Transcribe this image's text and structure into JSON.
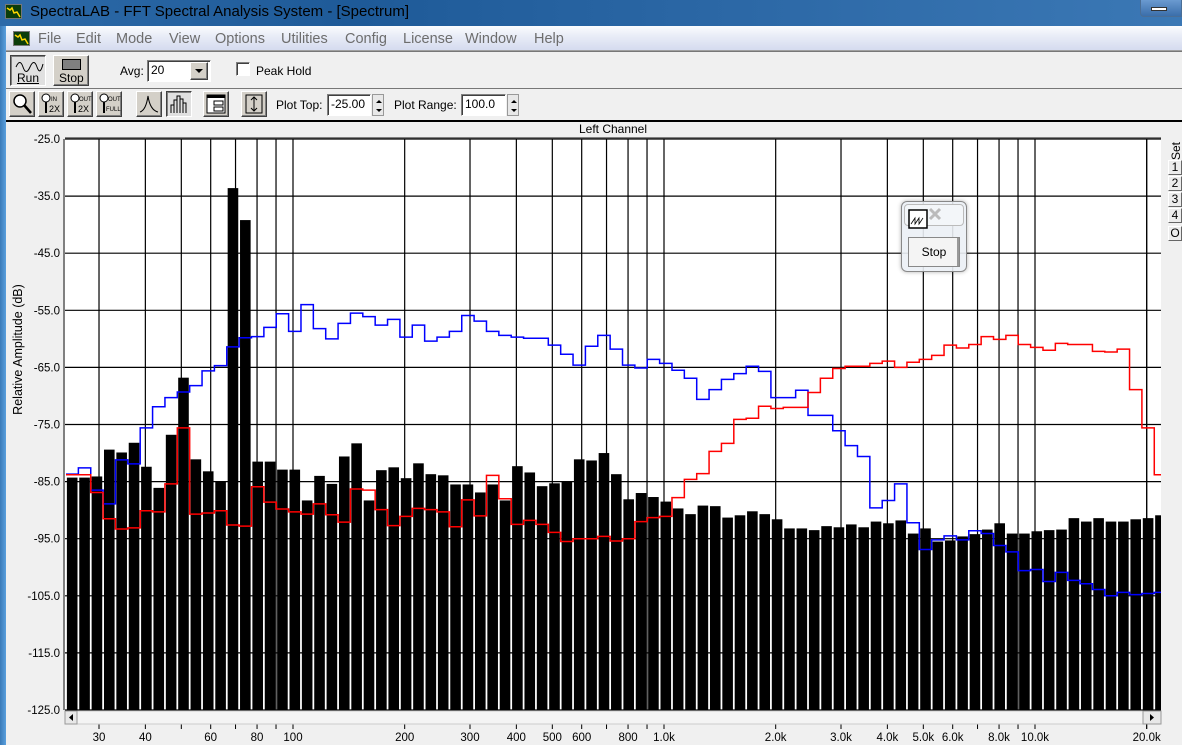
{
  "window": {
    "title": "SpectraLAB - FFT Spectral Analysis System - [Spectrum]"
  },
  "menu": [
    "File",
    "Edit",
    "Mode",
    "View",
    "Options",
    "Utilities",
    "Config",
    "License",
    "Window",
    "Help"
  ],
  "toolbar": {
    "run_label": "Run",
    "stop_label": "Stop",
    "avg_label": "Avg:",
    "avg_value": "20",
    "peak_hold_label": "Peak Hold",
    "peak_hold_checked": false,
    "plot_top_label": "Plot Top:",
    "plot_top_value": "-25.00",
    "plot_range_label": "Plot Range:",
    "plot_range_value": "100.0",
    "tools": [
      "zoom-icon",
      "zoom-in-2x-icon",
      "zoom-out-2x-icon",
      "zoom-out-full-icon",
      "line-mode-icon",
      "bar-mode-icon",
      "display-settings-icon",
      "autoscale-icon"
    ],
    "pressed_tool": "bar-mode-icon"
  },
  "set_panel": {
    "label": "Set",
    "buttons": [
      "1",
      "2",
      "3",
      "4",
      "O"
    ]
  },
  "mini_window": {
    "stop_label": "Stop"
  },
  "colors": {
    "bars": "#000000",
    "trace_blue": "#0000ff",
    "trace_red": "#ff0000",
    "grid": "#000000",
    "plot_bg": "#ffffff"
  },
  "chart_data": {
    "type": "bar",
    "title": "Left Channel",
    "ylabel": "Relative Amplitude (dB)",
    "xlabel": "",
    "x_scale": "log",
    "xlim": [
      24.4,
      21700
    ],
    "ylim": [
      -125,
      -25
    ],
    "grid": true,
    "yticks": [
      "-25.0",
      "-35.0",
      "-45.0",
      "-55.0",
      "-65.0",
      "-75.0",
      "-85.0",
      "-95.0",
      "-105.0",
      "-115.0",
      "-125.0"
    ],
    "xtick_labels": [
      {
        "f": 30,
        "l": "30"
      },
      {
        "f": 40,
        "l": "40"
      },
      {
        "f": 60,
        "l": "60"
      },
      {
        "f": 80,
        "l": "80"
      },
      {
        "f": 100,
        "l": "100"
      },
      {
        "f": 200,
        "l": "200"
      },
      {
        "f": 300,
        "l": "300"
      },
      {
        "f": 400,
        "l": "400"
      },
      {
        "f": 500,
        "l": "500"
      },
      {
        "f": 600,
        "l": "600"
      },
      {
        "f": 800,
        "l": "800"
      },
      {
        "f": 1000,
        "l": "1.0k"
      },
      {
        "f": 2000,
        "l": "2.0k"
      },
      {
        "f": 3000,
        "l": "3.0k"
      },
      {
        "f": 4000,
        "l": "4.0k"
      },
      {
        "f": 5000,
        "l": "5.0k"
      },
      {
        "f": 6000,
        "l": "6.0k"
      },
      {
        "f": 8000,
        "l": "8.0k"
      },
      {
        "f": 10000,
        "l": "10.0k"
      },
      {
        "f": 20000,
        "l": "20.0k"
      }
    ],
    "bin_start_hz": 25.4,
    "bins_per_decade": 30,
    "bars": [
      -84.3,
      -84.3,
      -84.1,
      -79.4,
      -79.9,
      -78.2,
      -82.4,
      -86.1,
      -76.8,
      -66.8,
      -81.1,
      -83.2,
      -85.0,
      -33.6,
      -39.2,
      -81.5,
      -81.5,
      -82.9,
      -82.9,
      -88.3,
      -84.0,
      -85.4,
      -80.6,
      -78.3,
      -88.3,
      -83.0,
      -82.5,
      -84.4,
      -81.8,
      -83.7,
      -83.9,
      -85.5,
      -85.5,
      -86.9,
      -85.5,
      -88.3,
      -82.3,
      -83.4,
      -85.8,
      -85.3,
      -84.9,
      -81.1,
      -81.3,
      -80.0,
      -83.7,
      -88.1,
      -87.0,
      -87.7,
      -88.5,
      -89.7,
      -90.7,
      -89.2,
      -89.3,
      -91.3,
      -90.9,
      -90.2,
      -90.7,
      -91.6,
      -93.2,
      -93.2,
      -93.5,
      -92.8,
      -93.0,
      -92.5,
      -93.0,
      -92.0,
      -92.3,
      -91.8,
      -94.1,
      -93.2,
      -95.5,
      -95.3,
      -94.6,
      -94.2,
      -93.4,
      -92.3,
      -94.1,
      -94.1,
      -93.7,
      -93.5,
      -93.4,
      -91.4,
      -92.0,
      -91.4,
      -92.0,
      -92.0,
      -91.6,
      -91.4,
      -90.9
    ],
    "series": [
      {
        "color": "#0000ff",
        "values": [
          -83.7,
          -82.6,
          -86.5,
          -88.9,
          -81.2,
          -81.9,
          -75.6,
          -71.9,
          -70.3,
          -69.3,
          -68.2,
          -65.6,
          -64.7,
          -61.4,
          -59.8,
          -59.6,
          -58.0,
          -55.6,
          -58.7,
          -54.0,
          -58.2,
          -60.0,
          -57.3,
          -55.5,
          -56.1,
          -57.6,
          -56.6,
          -59.7,
          -57.6,
          -60.4,
          -59.7,
          -58.7,
          -55.9,
          -56.9,
          -58.7,
          -59.4,
          -59.7,
          -59.9,
          -59.9,
          -61.1,
          -62.7,
          -64.6,
          -61.3,
          -59.4,
          -61.8,
          -64.6,
          -65.1,
          -63.6,
          -64.3,
          -65.5,
          -66.9,
          -70.6,
          -68.9,
          -67.1,
          -66.1,
          -64.8,
          -65.7,
          -70.3,
          -70.3,
          -69.0,
          -73.4,
          -73.4,
          -76.1,
          -78.7,
          -80.6,
          -89.6,
          -88.3,
          -85.4,
          -92.2,
          -96.9,
          -95.2,
          -94.5,
          -95.2,
          -93.6,
          -94.1,
          -96.2,
          -97.3,
          -100.6,
          -100.4,
          -102.5,
          -100.9,
          -102.3,
          -102.9,
          -103.9,
          -105.0,
          -104.4,
          -104.8,
          -104.6,
          -104.4
        ]
      },
      {
        "color": "#ff0000",
        "values": [
          -83.8,
          -83.8,
          -86.9,
          -91.5,
          -93.3,
          -93.1,
          -90.1,
          -90.3,
          -85.4,
          -75.6,
          -90.7,
          -90.5,
          -90.1,
          -92.6,
          -92.8,
          -85.9,
          -88.6,
          -89.8,
          -90.3,
          -90.7,
          -88.9,
          -90.8,
          -92.1,
          -86.3,
          -86.5,
          -89.9,
          -92.7,
          -91.1,
          -89.7,
          -89.9,
          -90.3,
          -92.9,
          -88.2,
          -91.0,
          -83.9,
          -88.0,
          -92.5,
          -91.8,
          -92.5,
          -93.9,
          -95.5,
          -95.0,
          -95.0,
          -94.6,
          -95.4,
          -95.0,
          -92.0,
          -91.3,
          -91.1,
          -87.8,
          -84.6,
          -83.6,
          -79.7,
          -78.3,
          -74.1,
          -73.9,
          -71.8,
          -72.2,
          -72.0,
          -72.0,
          -69.4,
          -66.9,
          -65.2,
          -64.8,
          -64.8,
          -64.3,
          -63.9,
          -65.0,
          -64.1,
          -63.6,
          -62.9,
          -61.1,
          -61.6,
          -61.0,
          -59.6,
          -60.1,
          -59.4,
          -61.0,
          -61.5,
          -62.0,
          -60.8,
          -61.0,
          -61.0,
          -62.2,
          -62.3,
          -61.8,
          -68.9,
          -75.6,
          -83.8
        ]
      }
    ]
  }
}
